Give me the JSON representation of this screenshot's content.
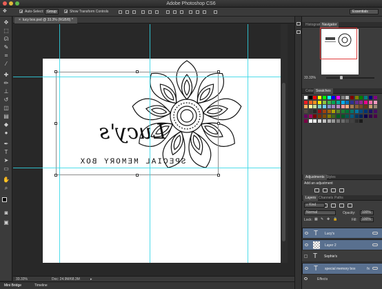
{
  "window": {
    "title": "Adobe Photoshop CS6"
  },
  "options_bar": {
    "auto_select_label": "Auto-Select:",
    "auto_select_value": "Group",
    "transform_label": "Show Transform Controls",
    "workspace": "Essentials"
  },
  "document": {
    "tab_label": "lucy box.psd @ 33.3% (RGB/8) *",
    "zoom": "33.33%",
    "doc_size": "Doc: 24.9M/68.3M"
  },
  "artwork": {
    "name": "Lucy's",
    "subtitle": "SPECIAL MEMORY BOX"
  },
  "navigator": {
    "tabs": [
      "Histogram",
      "Navigator"
    ],
    "zoom": "33.33%"
  },
  "color_panel": {
    "tabs": [
      "Color",
      "Swatches"
    ],
    "swatch_colors": [
      "#ffffff",
      "#000000",
      "#ff0000",
      "#ffff00",
      "#00ff00",
      "#00ffff",
      "#0000ff",
      "#ff00ff",
      "#808080",
      "#c0c0c0",
      "#800000",
      "#808000",
      "#008000",
      "#008080",
      "#000080",
      "#800080",
      "#ed1c24",
      "#f26522",
      "#f7941d",
      "#fff200",
      "#8dc63f",
      "#39b54a",
      "#00a651",
      "#00a99d",
      "#00aeef",
      "#0072bc",
      "#2e3192",
      "#662d91",
      "#92278f",
      "#ec008c",
      "#f06eaa",
      "#f49ac1",
      "#fbaf5d",
      "#fff799",
      "#c4df9b",
      "#7accc8",
      "#6dcff6",
      "#8493ca",
      "#a187be",
      "#bd8cbf",
      "#f5989d",
      "#f9ad81",
      "#a67c52",
      "#8c6239",
      "#754c24",
      "#603913",
      "#c69c6d",
      "#998675",
      "#534741",
      "#363636",
      "#262626",
      "#9e0b0f",
      "#a0410d",
      "#a36209",
      "#aba000",
      "#598527",
      "#1a7b30",
      "#007236",
      "#00746b",
      "#0076a3",
      "#004a80",
      "#003471",
      "#1b1464",
      "#440e62",
      "#630460",
      "#9e005d",
      "#790000",
      "#7b2e00",
      "#7d4900",
      "#827b00",
      "#406618",
      "#005e20",
      "#005826",
      "#005952",
      "#005b7f",
      "#003663",
      "#002157",
      "#0d004c",
      "#32004b",
      "#4b0049",
      "#7b0046",
      "#ffffff",
      "#ebebeb",
      "#d7d7d7",
      "#c2c2c2",
      "#acacac",
      "#989898",
      "#7d7d7d",
      "#6b6b6b",
      "#555555",
      "#424242",
      "#2c2c2c",
      "#1a1a1a"
    ]
  },
  "adjustments": {
    "tabs": [
      "Adjustments",
      "Styles"
    ],
    "heading": "Add an adjustment"
  },
  "layers": {
    "tabs": [
      "Layers",
      "Channels",
      "Paths"
    ],
    "kind": "Kind",
    "blend_mode": "Normal",
    "opacity_label": "Opacity:",
    "opacity": "100%",
    "lock_label": "Lock:",
    "fill_label": "Fill:",
    "fill": "100%",
    "items": [
      {
        "name": "Lucy's",
        "kind": "T",
        "selected": true
      },
      {
        "name": "Layer 2",
        "kind": "img",
        "selected": true
      },
      {
        "name": "Sophie's",
        "kind": "T",
        "selected": false
      },
      {
        "name": "special  memory  box",
        "kind": "T",
        "selected": true
      }
    ],
    "effects_label": "Effects"
  },
  "bottom_tabs": [
    "Mini Bridge",
    "Timeline"
  ],
  "colors": {
    "selection": "#59708f",
    "guide": "#2fd6e6",
    "accent": "#e03a3a"
  }
}
